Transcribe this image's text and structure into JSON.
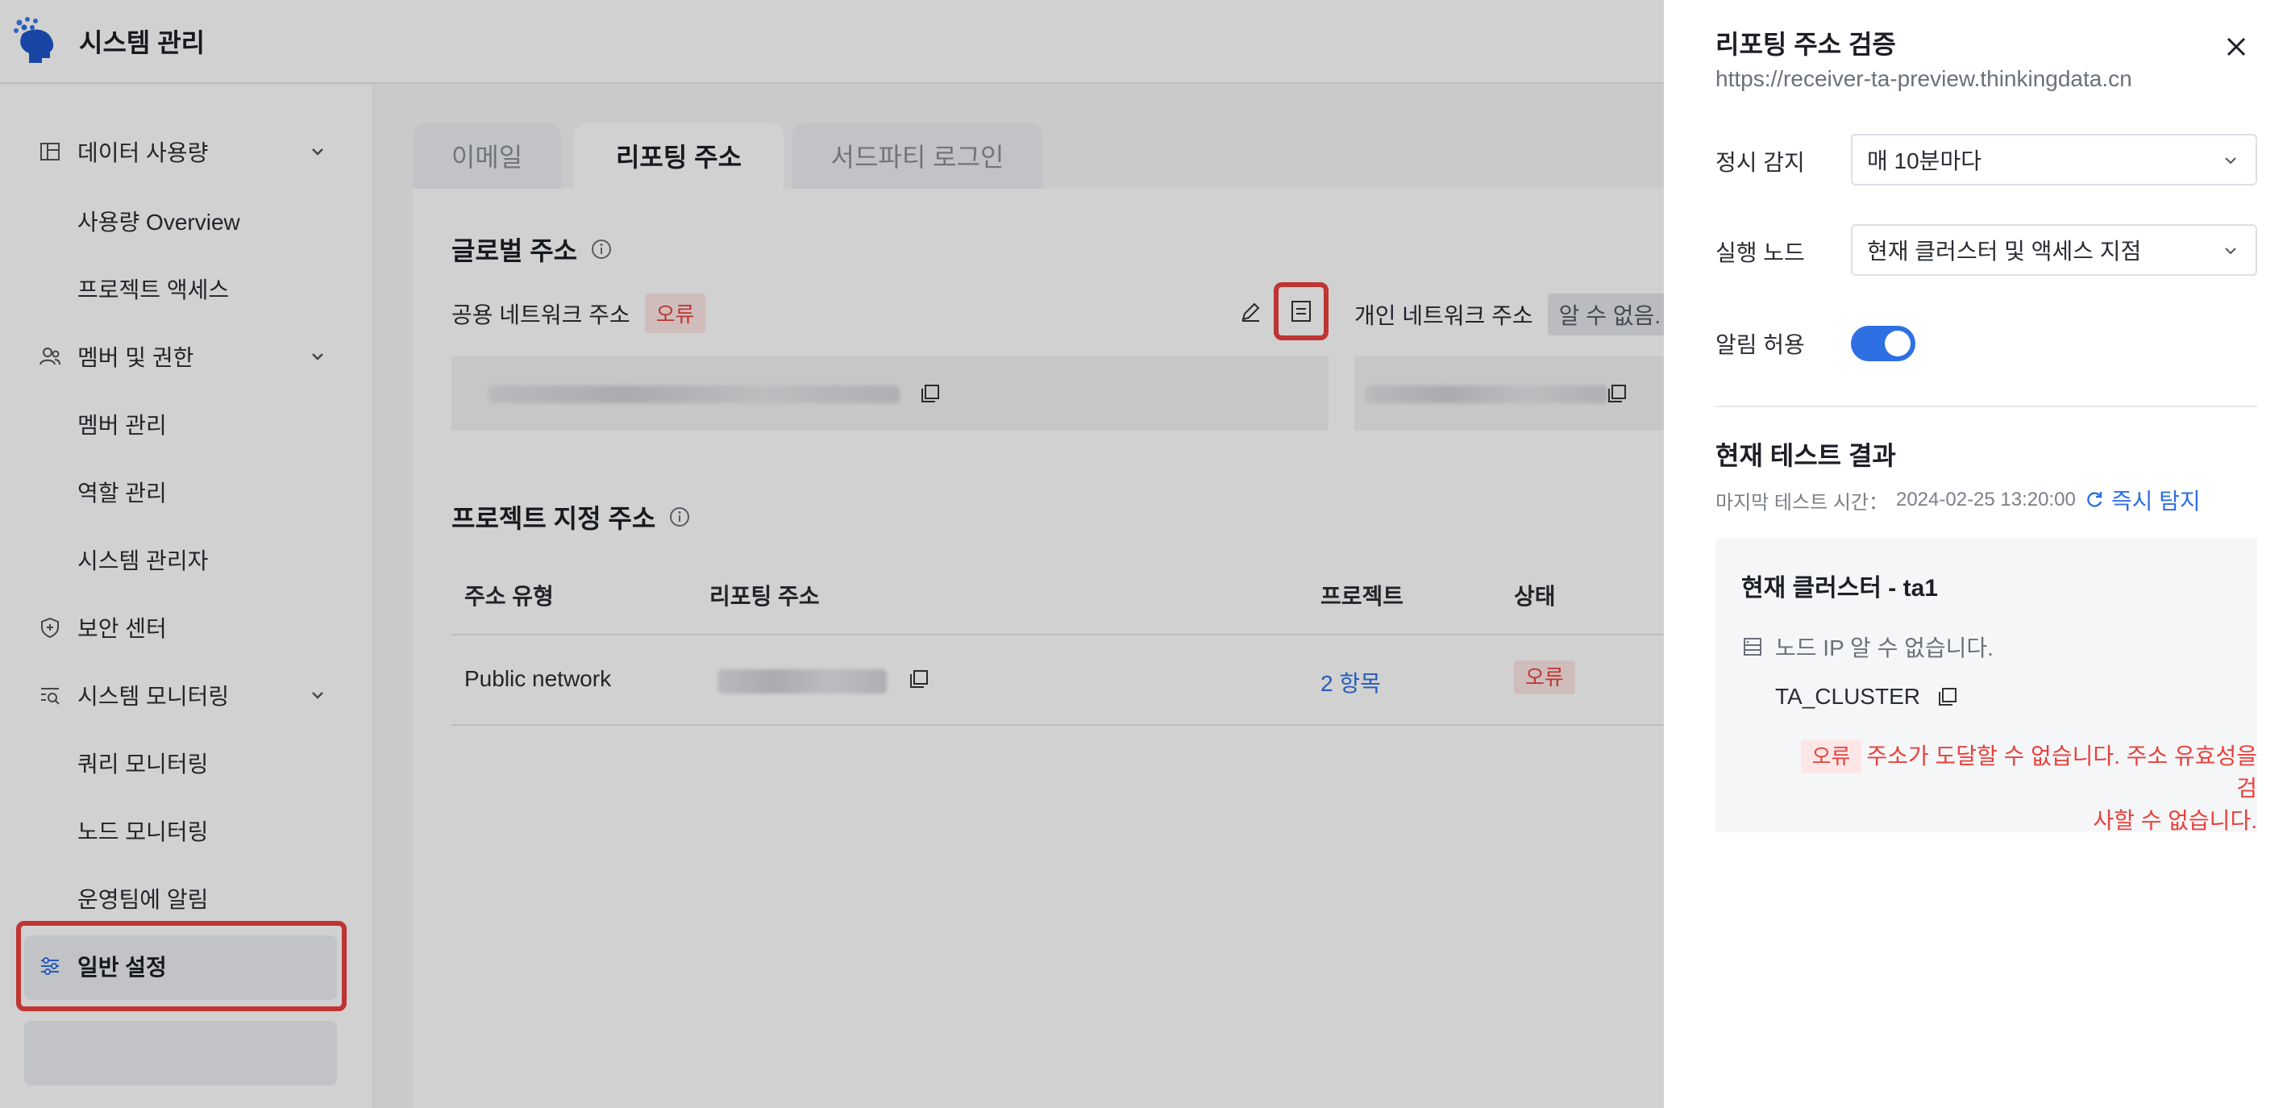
{
  "app": {
    "title": "시스템 관리"
  },
  "sidebar": {
    "groups": [
      {
        "label": "데이터 사용량",
        "icon": "data-usage-icon",
        "children": [
          "사용량 Overview",
          "프로젝트 액세스"
        ]
      },
      {
        "label": "멤버 및 권한",
        "icon": "members-icon",
        "children": [
          "멤버 관리",
          "역할 관리",
          "시스템 관리자"
        ]
      },
      {
        "label": "보안 센터",
        "icon": "shield-icon",
        "children": []
      },
      {
        "label": "시스템 모니터링",
        "icon": "monitoring-icon",
        "children": [
          "쿼리 모니터링",
          "노드 모니터링",
          "운영팀에 알림"
        ]
      },
      {
        "label": "일반 설정",
        "icon": "settings-sliders-icon",
        "children": []
      }
    ],
    "active_item": "일반 설정"
  },
  "tabs": [
    "이메일",
    "리포팅 주소",
    "서드파티 로그인"
  ],
  "active_tab": "리포팅 주소",
  "global": {
    "title": "글로벌 주소",
    "public_label": "공용 네트워크 주소",
    "public_status": "오류",
    "private_label": "개인 네트워크 주소",
    "private_status": "알 수 없음."
  },
  "project": {
    "title": "프로젝트 지정 주소",
    "columns": [
      "주소 유형",
      "리포팅 주소",
      "프로젝트",
      "상태"
    ],
    "rows": [
      {
        "type": "Public network",
        "address": "",
        "project": "2 항목",
        "status": "오류"
      }
    ]
  },
  "drawer": {
    "title": "리포팅 주소 검증",
    "url": "https://receiver-ta-preview.thinkingdata.cn",
    "schedule_label": "정시 감지",
    "schedule_value": "매 10분마다",
    "node_label": "실행 노드",
    "node_value": "현재 클러스터 및 액세스 지점",
    "alert_label": "알림 허용",
    "alert_enabled": true,
    "result_title": "현재 테스트 결과",
    "last_test_label": "마지막 테스트 시간：",
    "last_test_time": "2024-02-25 13:20:00",
    "detect_label": "즉시 탐지",
    "cluster_title": "현재 클러스터 - ta1",
    "node_ip_text": "노드 IP 알 수 없습니다.",
    "cluster_name": "TA_CLUSTER",
    "error_tag": "오류",
    "error_line1": "주소가 도달할 수 없습니다. 주소 유효성을 검",
    "error_line2": "사할 수 없습니다."
  },
  "colors": {
    "accent": "#2f6fe4",
    "error": "#e8413c",
    "highlight": "#e8413c"
  }
}
